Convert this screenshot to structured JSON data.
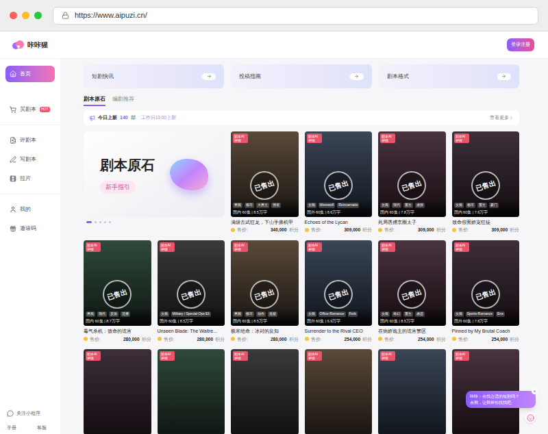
{
  "browser": {
    "url": "https://www.aipuzi.cn/"
  },
  "logo": "咔咔猩",
  "header": {
    "login": "登录注册"
  },
  "sidebar": {
    "groups": [
      [
        {
          "label": "首页",
          "selected": true,
          "badge": ""
        },
        {
          "label": "买剧本",
          "selected": false,
          "badge": "HOT"
        }
      ],
      [
        {
          "label": "评剧本",
          "selected": false,
          "badge": ""
        },
        {
          "label": "写剧本",
          "selected": false,
          "badge": ""
        },
        {
          "label": "拉片",
          "selected": false,
          "badge": ""
        }
      ],
      [
        {
          "label": "我的",
          "selected": false,
          "badge": ""
        },
        {
          "label": "邀请码",
          "selected": false,
          "badge": ""
        }
      ]
    ],
    "mini_program": "关注小程序",
    "links": [
      "手册",
      "客服"
    ]
  },
  "quick_cards": [
    {
      "label": "短剧快讯"
    },
    {
      "label": "投稿指南"
    },
    {
      "label": "剧本格式"
    }
  ],
  "tabs": [
    {
      "label": "剧本原石",
      "selected": true
    },
    {
      "label": "编剧推荐",
      "selected": false
    }
  ],
  "announcement": {
    "label": "今日上新",
    "count": "140",
    "unit": "部",
    "schedule": "工作日10:00上新",
    "more": "查看更多"
  },
  "banner": {
    "title": "剧本原石",
    "button": "新手指引",
    "slides": [
      {
        "selected": true
      },
      {
        "selected": false
      },
      {
        "selected": false
      },
      {
        "selected": false
      },
      {
        "selected": false
      }
    ]
  },
  "sold_stamp": "已售出",
  "scripts": [
    {
      "badge": "剧本AI 评级",
      "title": "满级古武狂龙，下山手撕机甲",
      "tags": [
        "男频",
        "都市",
        "大男主",
        "强者"
      ],
      "meta": "国内 60集 | 8.5万字",
      "price_label": "售价:",
      "price": "340,000",
      "unit": "积分",
      "sold": true
    },
    {
      "badge": "剧本AI 评级",
      "title": "Echoes of the Lycan",
      "tags": [
        "女频",
        "Werewolf",
        "Reincarnatio"
      ],
      "meta": "国外 60集 | 8.6万字",
      "price_label": "售价:",
      "price": "309,000",
      "unit": "积分",
      "sold": true
    },
    {
      "badge": "剧本AI 评级",
      "title": "死局诱捕京圈太子",
      "tags": [
        "女频",
        "现代",
        "重生",
        "虐甜"
      ],
      "meta": "国内 60集 | 7.8万字",
      "price_label": "售价:",
      "price": "309,000",
      "unit": "积分",
      "sold": true
    },
    {
      "badge": "剧本AI 评级",
      "title": "致命假面娇宠狂徒",
      "tags": [
        "女频",
        "都市",
        "重生",
        "豪门"
      ],
      "meta": "国内 60集 | 7.6万字",
      "price_label": "售价:",
      "price": "309,000",
      "unit": "积分",
      "sold": true
    },
    {
      "badge": "剧本AI 评级",
      "title": "毒气杀机：致命的谎言",
      "tags": [
        "男频",
        "现代",
        "反派",
        "逆袭"
      ],
      "meta": "国内 60集 | 8.7万字",
      "price_label": "售价:",
      "price": "280,000",
      "unit": "积分",
      "sold": true
    },
    {
      "badge": "剧本AI 评级",
      "title": "Unseen Blade: The Waitre...",
      "tags": [
        "女频",
        "Military / Special-Ops Eli"
      ],
      "meta": "国外 60集 | 8.5万字",
      "price_label": "售价:",
      "price": "280,000",
      "unit": "积分",
      "sold": true
    },
    {
      "badge": "剧本AI 评级",
      "title": "极寒绝命：冰封的良知",
      "tags": [
        "男频",
        "都市",
        "动作",
        "悬疑"
      ],
      "meta": "国内 60集 | 8.5万字",
      "price_label": "售价:",
      "price": "280,000",
      "unit": "积分",
      "sold": true
    },
    {
      "badge": "剧本AI 评级",
      "title": "Surrender to the Rival CEO",
      "tags": [
        "女频",
        "Office-Romance",
        "Forb"
      ],
      "meta": "国外 60集 | 6.9万字",
      "price_label": "售价:",
      "price": "254,000",
      "unit": "积分",
      "sold": true
    },
    {
      "badge": "剧本AI 评级",
      "title": "在病娇诡主的谎言禁区",
      "tags": [
        "女频",
        "奇幻",
        "重生",
        "虐恋"
      ],
      "meta": "国内 60集 | 8.5万字",
      "price_label": "售价:",
      "price": "254,000",
      "unit": "积分",
      "sold": true
    },
    {
      "badge": "剧本AI 评级",
      "title": "Pinned by My Brutal Coach",
      "tags": [
        "女频",
        "Sports-Romance",
        "Ene"
      ],
      "meta": "国外 60集 | 7.8万字",
      "price_label": "售价:",
      "price": "254,000",
      "unit": "积分",
      "sold": true
    }
  ],
  "partial_scripts": [
    {
      "badge": "剧本AI 评级",
      "sold": false
    },
    {
      "badge": "剧本AI 评级",
      "sold": false
    },
    {
      "badge": "剧本AI 评级",
      "sold": false
    },
    {
      "badge": "剧本AI 评级",
      "sold": false
    },
    {
      "badge": "剧本AI 评级",
      "sold": false
    },
    {
      "badge": "剧本AI 评级",
      "sold": false
    }
  ],
  "chat": {
    "lines": [
      "咔咔：在找合适的短剧吗？",
      "点我，让我帮你找找吧"
    ],
    "close": "×"
  }
}
